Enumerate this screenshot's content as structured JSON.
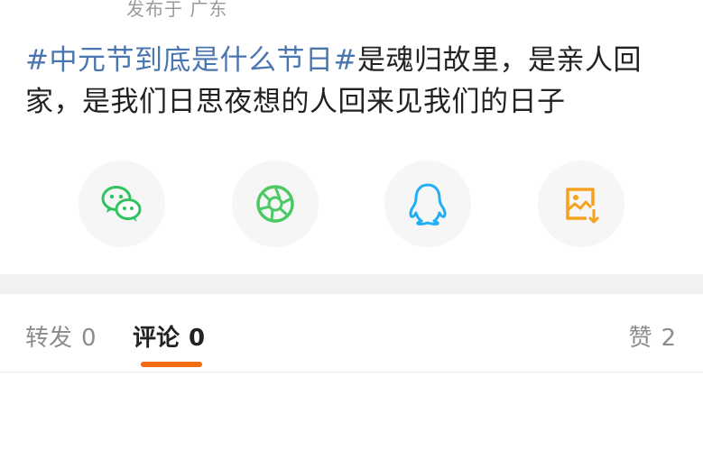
{
  "post": {
    "meta": "发布于 广东",
    "hashtag": "#中元节到底是什么节日#",
    "body": "是魂归故里，是亲人回家，是我们日思夜想的人回来见我们的日子"
  },
  "share": {
    "buttons": [
      {
        "name": "wechat",
        "icon": "wechat-icon",
        "color": "#2fc361"
      },
      {
        "name": "moments",
        "icon": "camera-aperture-icon",
        "color": "#4cc964"
      },
      {
        "name": "qq",
        "icon": "qq-penguin-icon",
        "color": "#22aef2"
      },
      {
        "name": "save-image",
        "icon": "save-image-icon",
        "color": "#f4a21e"
      }
    ]
  },
  "tabs": {
    "repost": {
      "label": "转发",
      "count": "0"
    },
    "comments": {
      "label": "评论",
      "count": "0",
      "active": true
    },
    "likes": {
      "label": "赞",
      "count": "2"
    },
    "accent": "#f26c12"
  }
}
